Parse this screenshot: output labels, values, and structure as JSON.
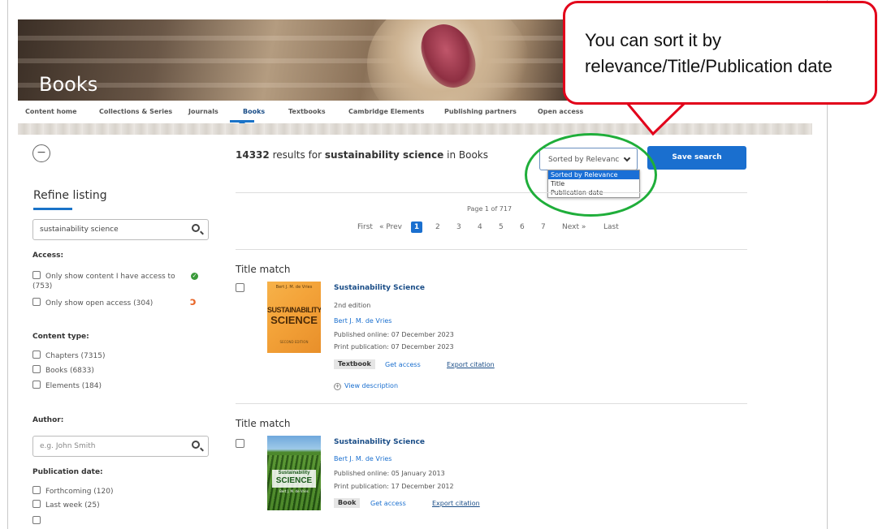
{
  "banner": {
    "title": "Books"
  },
  "nav": {
    "items": [
      {
        "label": "Content home"
      },
      {
        "label": "Collections & Series"
      },
      {
        "label": "Journals"
      },
      {
        "label": "Books"
      },
      {
        "label": "Textbooks"
      },
      {
        "label": "Cambridge Elements"
      },
      {
        "label": "Publishing partners"
      },
      {
        "label": "Open access"
      }
    ],
    "active": "Books"
  },
  "sidebar": {
    "collapse_symbol": "−",
    "refine_title": "Refine listing",
    "search_value": "sustainability science",
    "access": {
      "heading": "Access:",
      "options": [
        {
          "label": "Only show content I have access to",
          "count": "(753)"
        },
        {
          "label": "Only show open access (304)"
        }
      ]
    },
    "content_type": {
      "heading": "Content type:",
      "options": [
        {
          "label": "Chapters (7315)"
        },
        {
          "label": "Books (6833)"
        },
        {
          "label": "Elements (184)"
        }
      ]
    },
    "author": {
      "heading": "Author:",
      "placeholder": "e.g. John Smith"
    },
    "publication_date": {
      "heading": "Publication date:",
      "options": [
        {
          "label": "Forthcoming (120)"
        },
        {
          "label": "Last week (25)"
        }
      ]
    }
  },
  "results": {
    "count": "14332",
    "mid_text": " results for ",
    "query": "sustainability science",
    "suffix": " in Books",
    "sort": {
      "selected": "Sorted by Relevance",
      "options": [
        "Sorted by Relevance",
        "Title",
        "Publication date"
      ]
    },
    "save_search": "Save search",
    "pagination": {
      "page_of": "Page 1 of 717",
      "first": "First",
      "prev": "« Prev",
      "pages": [
        "1",
        "2",
        "3",
        "4",
        "5",
        "6",
        "7"
      ],
      "current": "1",
      "next": "Next »",
      "last": "Last"
    },
    "items": [
      {
        "match": "Title match",
        "title": "Sustainability Science",
        "edition": "2nd edition",
        "author": "Bert J. M. de Vries",
        "published_online": "Published online: 07 December 2023",
        "print_publication": "Print publication: 07 December 2023",
        "badge": "Textbook",
        "get_access": "Get access",
        "export": "Export citation",
        "view_description": "View description",
        "cover": {
          "top_text": "Bert J. M. de Vries",
          "line1": "SUSTAINABILITY",
          "line2": "SCIENCE",
          "bottom_text": "SECOND EDITION"
        }
      },
      {
        "match": "Title match",
        "title": "Sustainability Science",
        "author": "Bert J. M. de Vries",
        "published_online": "Published online: 05 January 2013",
        "print_publication": "Print publication: 17 December 2012",
        "badge": "Book",
        "get_access": "Get access",
        "export": "Export citation",
        "cover": {
          "line1": "Sustainability",
          "line2": "SCIENCE",
          "bottom_text": "Bert J. M. de Vries"
        }
      }
    ]
  },
  "annotation": {
    "callout_text": "You can sort it by relevance/Title/Publication date",
    "colors": {
      "callout_border": "#e2001a",
      "circle": "#1fae3a"
    }
  },
  "colors": {
    "primary": "#1a6fcf",
    "link": "#1a4d87"
  }
}
